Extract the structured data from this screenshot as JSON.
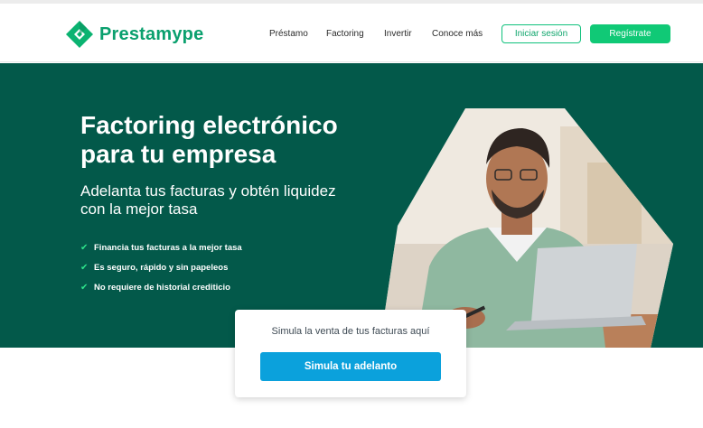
{
  "brand": {
    "name": "Prestamype",
    "color": "#0aa06e"
  },
  "nav": {
    "items": [
      "Préstamo",
      "Factoring",
      "Invertir",
      "Conoce más"
    ]
  },
  "header_actions": {
    "login_label": "Iniciar sesión",
    "register_label": "Regístrate"
  },
  "hero": {
    "title": "Factoring electrónico para tu empresa",
    "subtitle": "Adelanta tus facturas y obtén liquidez con la mejor tasa",
    "bullets": [
      "Financia tus facturas a la mejor tasa",
      "Es seguro, rápido y sin papeleos",
      "No requiere de historial crediticio"
    ],
    "background": "#03594a"
  },
  "simulator": {
    "prompt": "Simula la venta de tus facturas aquí",
    "button_label": "Simula tu adelanto",
    "button_color": "#0ba1dc"
  }
}
